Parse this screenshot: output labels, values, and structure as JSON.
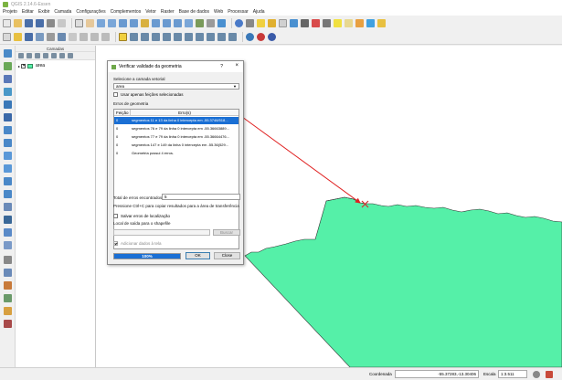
{
  "app": {
    "title": "QGIS 2.14.6-Essen",
    "menu": [
      "Projeto",
      "Editar",
      "Exibir",
      "Camada",
      "Configurações",
      "Complementos",
      "Vetor",
      "Raster",
      "Base de dados",
      "Web",
      "Processar",
      "Ajuda"
    ]
  },
  "layers_panel": {
    "title": "Camadas",
    "layers": [
      {
        "name": "area",
        "visible": true,
        "color": "#55f0a8"
      }
    ]
  },
  "dialog": {
    "title": "Verificar validade da geometria",
    "help": "?",
    "close": "×",
    "select_layer_label": "Selecione a camada vetorial",
    "selected_layer": "area",
    "only_selected_label": "Usar apenas feições selecionadas",
    "errors_label": "Erros de geometria",
    "table_headers": {
      "position": "Feição",
      "error": "Erro(s)"
    },
    "rows": [
      {
        "pos": "0",
        "err": "segmentos 11 e 13 da linha 0 intercepta em -55.3746/518...",
        "selected": true
      },
      {
        "pos": "0",
        "err": "segmentos 76 e 79 da linha 0 intercepta em -55.36663889...",
        "selected": false
      },
      {
        "pos": "0",
        "err": "segmentos 77 e 79 da linha 0 intercepta em -55.36664476...",
        "selected": false
      },
      {
        "pos": "0",
        "err": "segmentos 147 e 149 da linha 0 intercepta em -55.36(529...",
        "selected": false
      },
      {
        "pos": "0",
        "err": "Geometria possui 4 erros.",
        "selected": false
      }
    ],
    "total_label": "Total de erros encontrados",
    "total_value": "5",
    "hint": "Pressione Ctrl+C para copiar resultados para a área de transferência",
    "save_label": "Salvar erros de localização",
    "output_label": "Local de saída para o shapefile",
    "browse_label": "Buscar",
    "add_label": "Adicionar dados à tela",
    "progress_value": 100,
    "progress_text": "100%",
    "ok_label": "OK",
    "close_label": "Close"
  },
  "status": {
    "coord_label": "Coordenada",
    "coord_value": "-55.37283,-13.30406",
    "scale_label": "Escala",
    "scale_value": "1:3.511"
  },
  "colors": {
    "polygon_fill": "#55f0a8",
    "polygon_stroke": "#333333",
    "arrow": "#e02020",
    "selection": "#1a6fd4"
  }
}
